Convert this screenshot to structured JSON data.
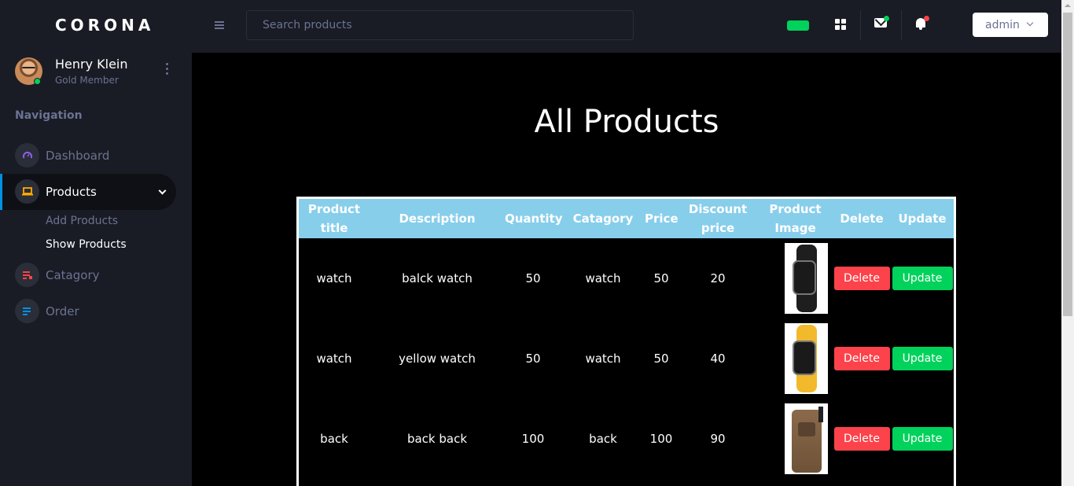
{
  "brand": "CORONA",
  "profile": {
    "name": "Henry Klein",
    "role": "Gold Member"
  },
  "nav": {
    "caption": "Navigation",
    "items": [
      {
        "label": "Dashboard",
        "icon": "speedometer-icon",
        "color": "#8f5fe8"
      },
      {
        "label": "Products",
        "icon": "laptop-icon",
        "color": "#ffab00",
        "active": true
      },
      {
        "label": "Catagory",
        "icon": "playlist-icon",
        "color": "#fc424a"
      },
      {
        "label": "Order",
        "icon": "list-icon",
        "color": "#0090e7"
      }
    ],
    "sub_items": [
      {
        "label": "Add Products"
      },
      {
        "label": "Show Products",
        "active": true
      }
    ]
  },
  "header": {
    "search_placeholder": "Search products",
    "user_menu": "admin"
  },
  "main": {
    "title": "All Products",
    "columns": [
      "Product title",
      "Description",
      "Quantity",
      "Catagory",
      "Price",
      "Discount price",
      "Product Image",
      "Delete",
      "Update"
    ],
    "rows": [
      {
        "title": "watch",
        "description": "balck watch",
        "quantity": "50",
        "category": "watch",
        "price": "50",
        "discount": "20",
        "image": "black-watch-image",
        "band_color": "#1e1e1e"
      },
      {
        "title": "watch",
        "description": "yellow watch",
        "quantity": "50",
        "category": "watch",
        "price": "50",
        "discount": "40",
        "image": "yellow-watch-image",
        "band_color": "#f2b92c"
      },
      {
        "title": "back",
        "description": "back back",
        "quantity": "100",
        "category": "back",
        "price": "100",
        "discount": "90",
        "image": "backpack-image"
      }
    ],
    "delete_label": "Delete",
    "update_label": "Update"
  },
  "colors": {
    "accent": "#0090e7",
    "success": "#00d25b",
    "danger": "#fc424a",
    "table_header": "#87ceeb"
  }
}
